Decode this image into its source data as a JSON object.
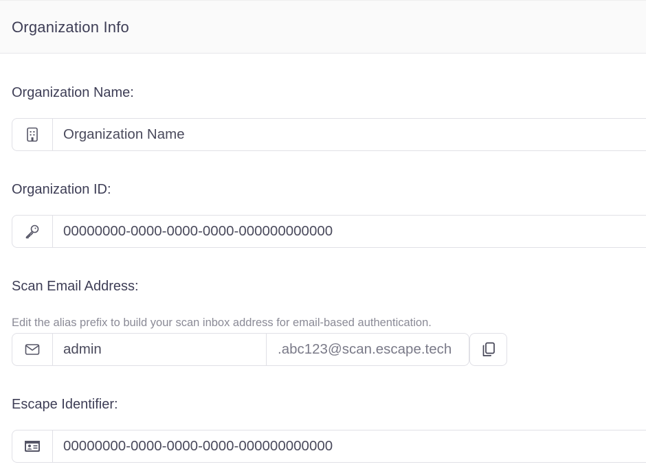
{
  "header": {
    "title": "Organization Info"
  },
  "organization_name": {
    "label": "Organization Name:",
    "value": "Organization Name",
    "icon": "building-icon"
  },
  "organization_id": {
    "label": "Organization ID:",
    "value": "00000000-0000-0000-0000-000000000000",
    "icon": "key-icon"
  },
  "scan_email": {
    "label": "Scan Email Address:",
    "helper": "Edit the alias prefix to build your scan inbox address for email-based authentication.",
    "prefix_value": "admin",
    "suffix": ".abc123@scan.escape.tech",
    "icon": "mail-icon",
    "copy_icon": "copy-icon"
  },
  "escape_identifier": {
    "label": "Escape Identifier:",
    "value": "00000000-0000-0000-0000-000000000000",
    "icon": "id-card-icon"
  }
}
